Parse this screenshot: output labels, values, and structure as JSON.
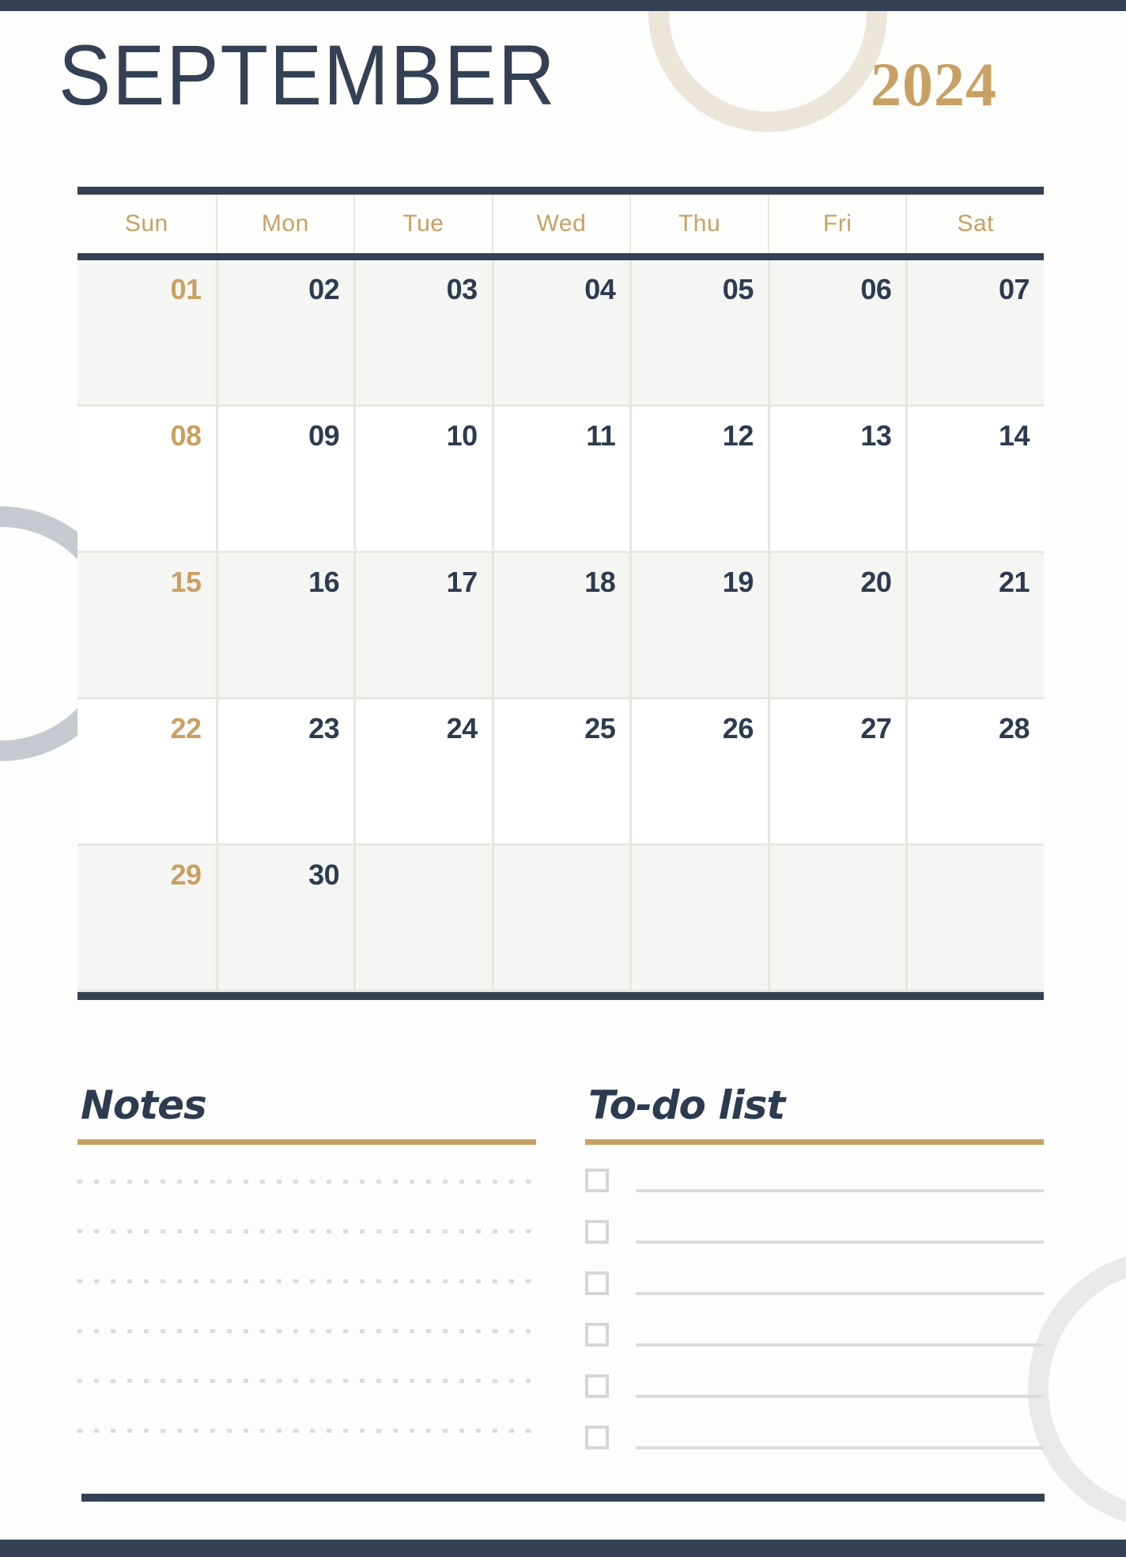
{
  "header": {
    "month": "SEPTEMBER",
    "year": "2024"
  },
  "calendar": {
    "weekdays": [
      "Sun",
      "Mon",
      "Tue",
      "Wed",
      "Thu",
      "Fri",
      "Sat"
    ],
    "weeks": [
      [
        "01",
        "02",
        "03",
        "04",
        "05",
        "06",
        "07"
      ],
      [
        "08",
        "09",
        "10",
        "11",
        "12",
        "13",
        "14"
      ],
      [
        "15",
        "16",
        "17",
        "18",
        "19",
        "20",
        "21"
      ],
      [
        "22",
        "23",
        "24",
        "25",
        "26",
        "27",
        "28"
      ],
      [
        "29",
        "30",
        "",
        "",
        "",
        "",
        ""
      ]
    ]
  },
  "notes": {
    "title": "Notes",
    "line_count": 6
  },
  "todo": {
    "title": "To-do list",
    "items": [
      "",
      "",
      "",
      "",
      "",
      ""
    ]
  },
  "colors": {
    "navy": "#344154",
    "gold": "#c9a063",
    "grid": "#e3e9df",
    "shaded_row": "#f5f6f4",
    "ring_beige": "#ece5d9",
    "ring_blue_gray": "#c4cad0",
    "ring_light_gray": "#e9e9e9"
  }
}
